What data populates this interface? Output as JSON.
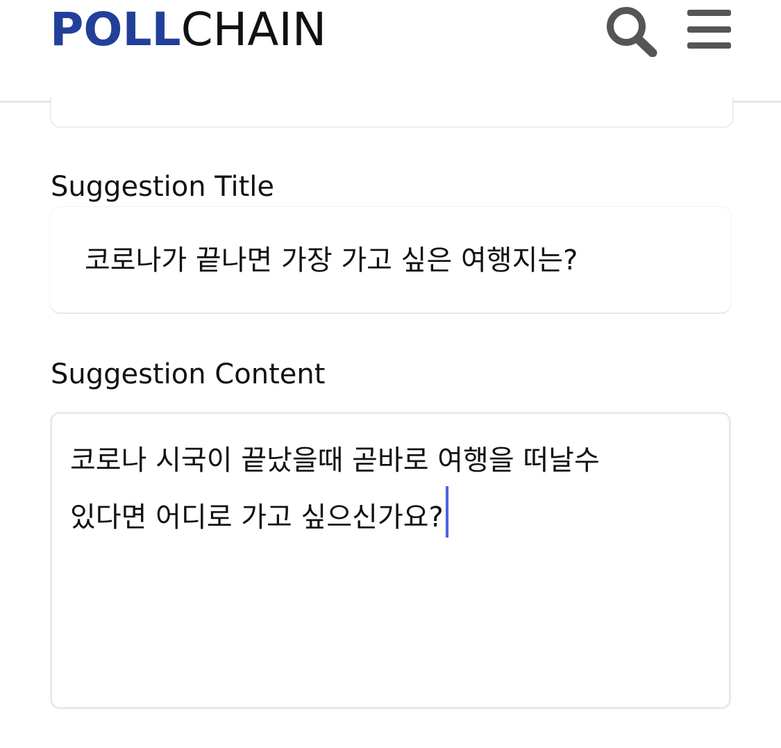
{
  "header": {
    "logo_bold": "POLL",
    "logo_light": "CHAIN",
    "search_icon": "search-icon",
    "menu_icon": "hamburger-menu-icon"
  },
  "form": {
    "title_label": "Suggestion Title",
    "title_value": "코로나가 끝나면 가장 가고 싶은 여행지는?",
    "content_label": "Suggestion Content",
    "content_line1": "코로나 시국이 끝났을때 곧바로 여행을 떠날수",
    "content_line2": "있다면 어디로 가고 싶으신가요?"
  },
  "colors": {
    "brand": "#22409a",
    "icon": "#555555",
    "caret": "#4a63e0"
  }
}
